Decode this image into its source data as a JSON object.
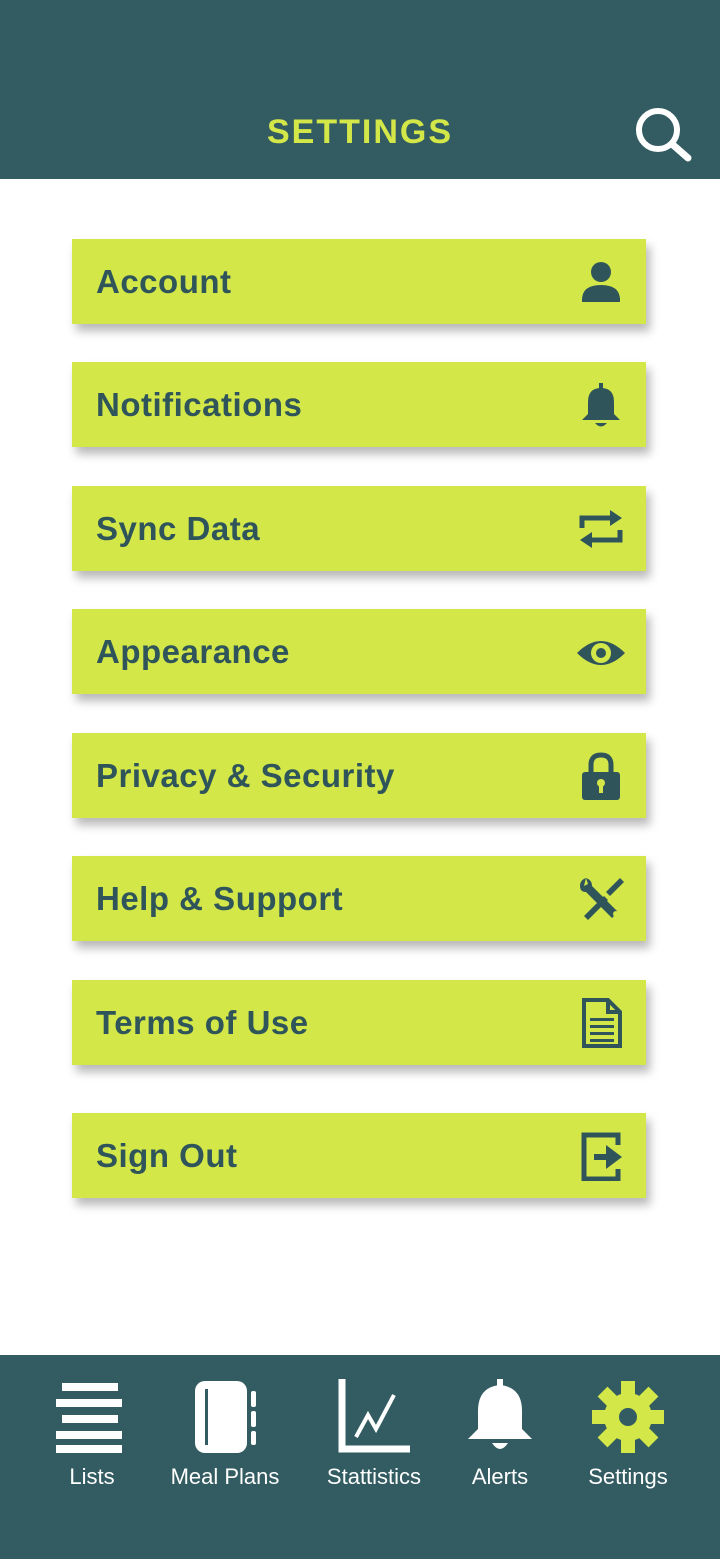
{
  "header": {
    "title": "SETTINGS",
    "search_icon": "search-icon"
  },
  "colors": {
    "header_bg": "#335c62",
    "accent": "#d3e749",
    "item_text": "#2f555b",
    "nav_icon": "#ffffff",
    "nav_active_icon": "#d3e749"
  },
  "menu": {
    "items": [
      {
        "label": "Account",
        "icon": "user-icon"
      },
      {
        "label": "Notifications",
        "icon": "bell-icon"
      },
      {
        "label": "Sync Data",
        "icon": "sync-icon"
      },
      {
        "label": "Appearance",
        "icon": "eye-icon"
      },
      {
        "label": "Privacy & Security",
        "icon": "lock-icon"
      },
      {
        "label": "Help & Support",
        "icon": "tools-icon"
      },
      {
        "label": "Terms of Use",
        "icon": "document-icon"
      },
      {
        "label": "Sign Out",
        "icon": "sign-out-icon"
      }
    ]
  },
  "nav": {
    "items": [
      {
        "label": "Lists",
        "icon": "lists-icon",
        "active": false
      },
      {
        "label": "Meal Plans",
        "icon": "notebook-icon",
        "active": false
      },
      {
        "label": "Stattistics",
        "icon": "chart-icon",
        "active": false
      },
      {
        "label": "Alerts",
        "icon": "bell-icon",
        "active": false
      },
      {
        "label": "Settings",
        "icon": "gear-icon",
        "active": true
      }
    ]
  }
}
